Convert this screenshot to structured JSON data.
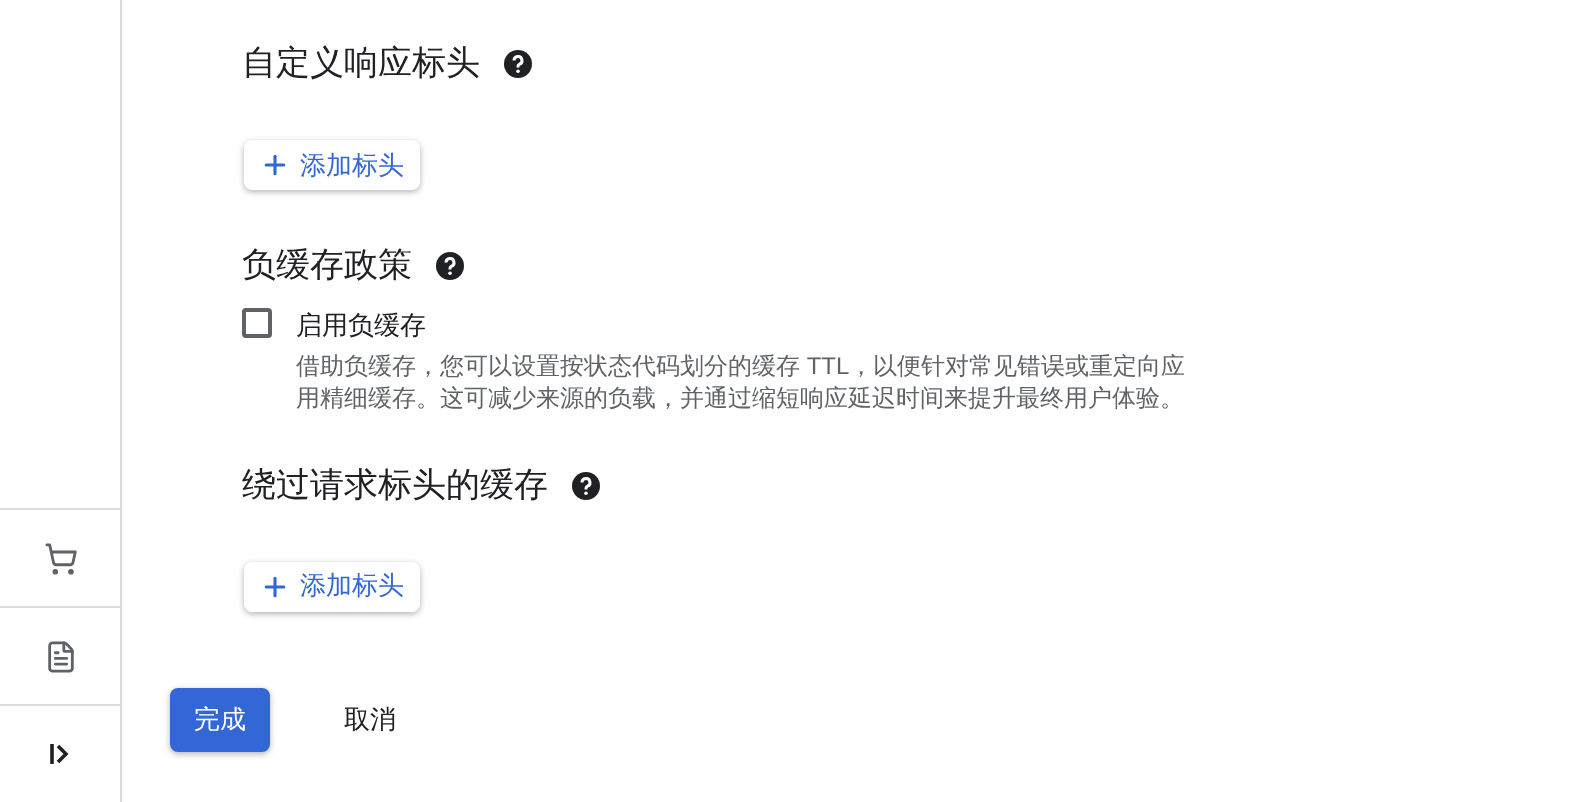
{
  "sidebar": {
    "items": [
      {
        "kind": "cart"
      },
      {
        "kind": "note"
      },
      {
        "kind": "expand"
      }
    ]
  },
  "sections": [
    {
      "title": "自定义响应标头",
      "help": true,
      "button": "添加标头"
    },
    {
      "title": "负缓存政策",
      "help": true,
      "checkbox": {
        "label": "启用负缓存",
        "checked": false,
        "description": "借助负缓存，您可以设置按状态代码划分的缓存 TTL，以便针对常见错误或重定向应用精细缓存。这可减少来源的负载，并通过缩短响应延迟时间来提升最终用户体验。"
      }
    },
    {
      "title": "绕过请求标头的缓存",
      "help": true,
      "button": "添加标头"
    }
  ],
  "actions": {
    "primary": "完成",
    "secondary": "取消"
  }
}
